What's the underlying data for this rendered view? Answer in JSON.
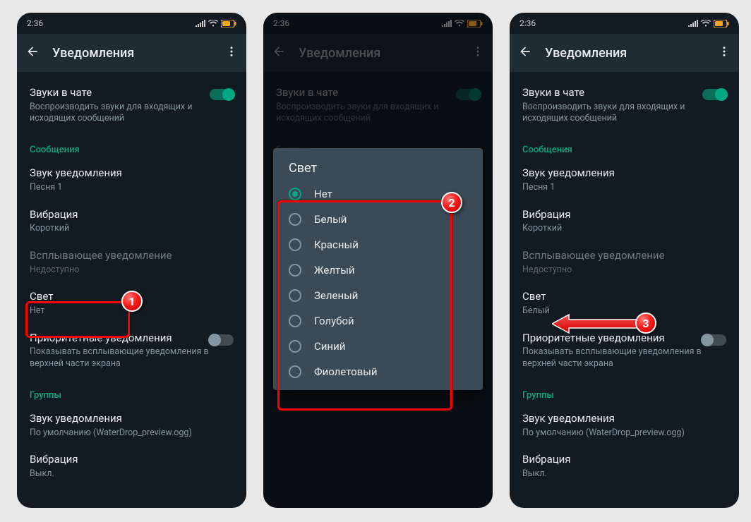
{
  "status": {
    "time": "2:36"
  },
  "header": {
    "title": "Уведомления"
  },
  "chat_sounds": {
    "label": "Звуки в чате",
    "sub": "Воспроизводить звуки для входящих и исходящих сообщений"
  },
  "sections": {
    "messages": "Сообщения",
    "groups": "Группы"
  },
  "items": {
    "sound": {
      "label": "Звук уведомления",
      "sub": "Песня 1"
    },
    "vibration": {
      "label": "Вибрация",
      "sub": "Короткий"
    },
    "popup": {
      "label": "Всплывающее уведомление",
      "sub": "Недоступно"
    },
    "light_s1": {
      "label": "Свет",
      "sub": "Нет"
    },
    "light_s3": {
      "label": "Свет",
      "sub": "Белый"
    },
    "priority": {
      "label": "Приоритетные уведомления",
      "sub": "Показывать всплывающие уведомления в верхней части экрана"
    },
    "grp_sound": {
      "label": "Звук уведомления",
      "sub": "По умолчанию (WaterDrop_preview.ogg)"
    },
    "grp_vib": {
      "label": "Вибрация",
      "sub": "Выкл."
    }
  },
  "dialog": {
    "title": "Свет",
    "options": [
      "Нет",
      "Белый",
      "Красный",
      "Желтый",
      "Зеленый",
      "Голубой",
      "Синий",
      "Фиолетовый"
    ],
    "selected": 0
  },
  "steps": {
    "s1": "1",
    "s2": "2",
    "s3": "3"
  }
}
